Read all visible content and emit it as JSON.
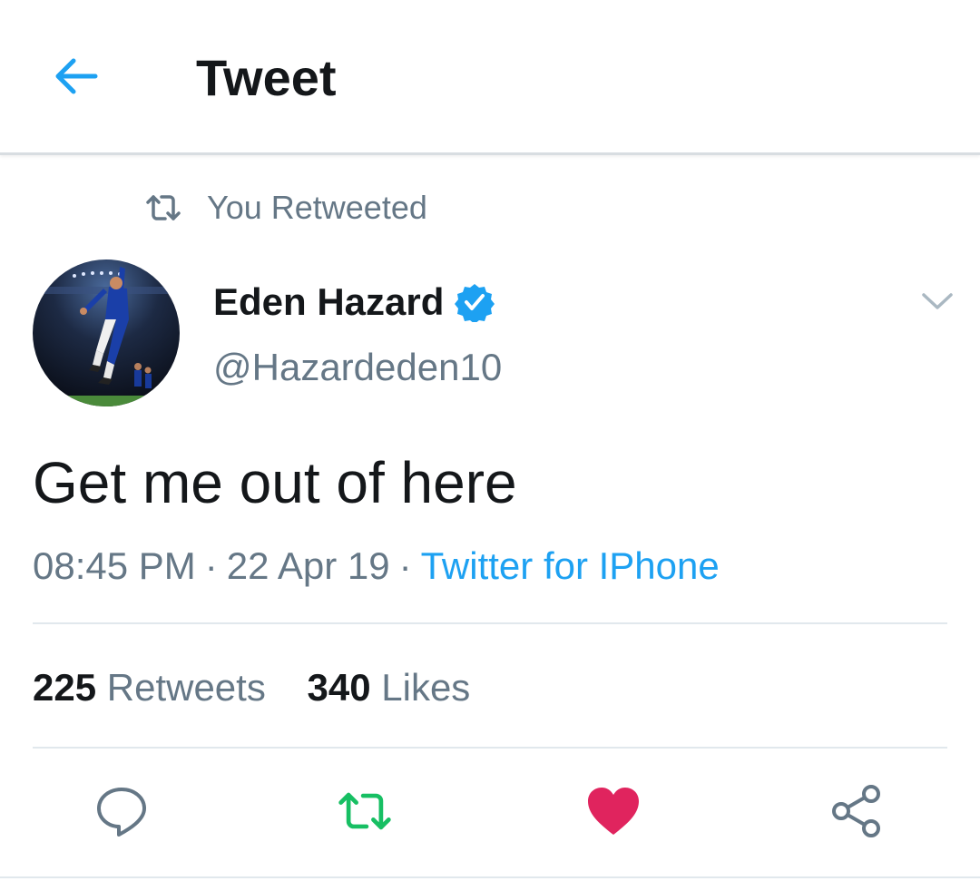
{
  "header": {
    "title": "Tweet",
    "back_icon": "arrow-left-icon"
  },
  "colors": {
    "accent": "#1da1f2",
    "text_primary": "#14171a",
    "text_secondary": "#657786",
    "retweet_green": "#17bf63",
    "like_red": "#e0245e",
    "divider": "#e1e8ed"
  },
  "retweet_banner": {
    "icon": "retweet-icon",
    "text": "You Retweeted"
  },
  "tweet": {
    "author_name": "Eden Hazard",
    "verified_icon": "verified-badge-icon",
    "handle": "@Hazardeden10",
    "text": "Get me out of here",
    "time": "08:45 PM",
    "date": "22 Apr 19",
    "source": "Twitter for IPhone",
    "menu_icon": "chevron-down-icon"
  },
  "stats": {
    "retweets_count": "225",
    "retweets_label": "Retweets",
    "likes_count": "340",
    "likes_label": "Likes"
  },
  "actions": [
    {
      "icon": "reply-icon"
    },
    {
      "icon": "retweet-icon",
      "state": "active"
    },
    {
      "icon": "heart-icon",
      "state": "liked"
    },
    {
      "icon": "share-icon"
    }
  ]
}
